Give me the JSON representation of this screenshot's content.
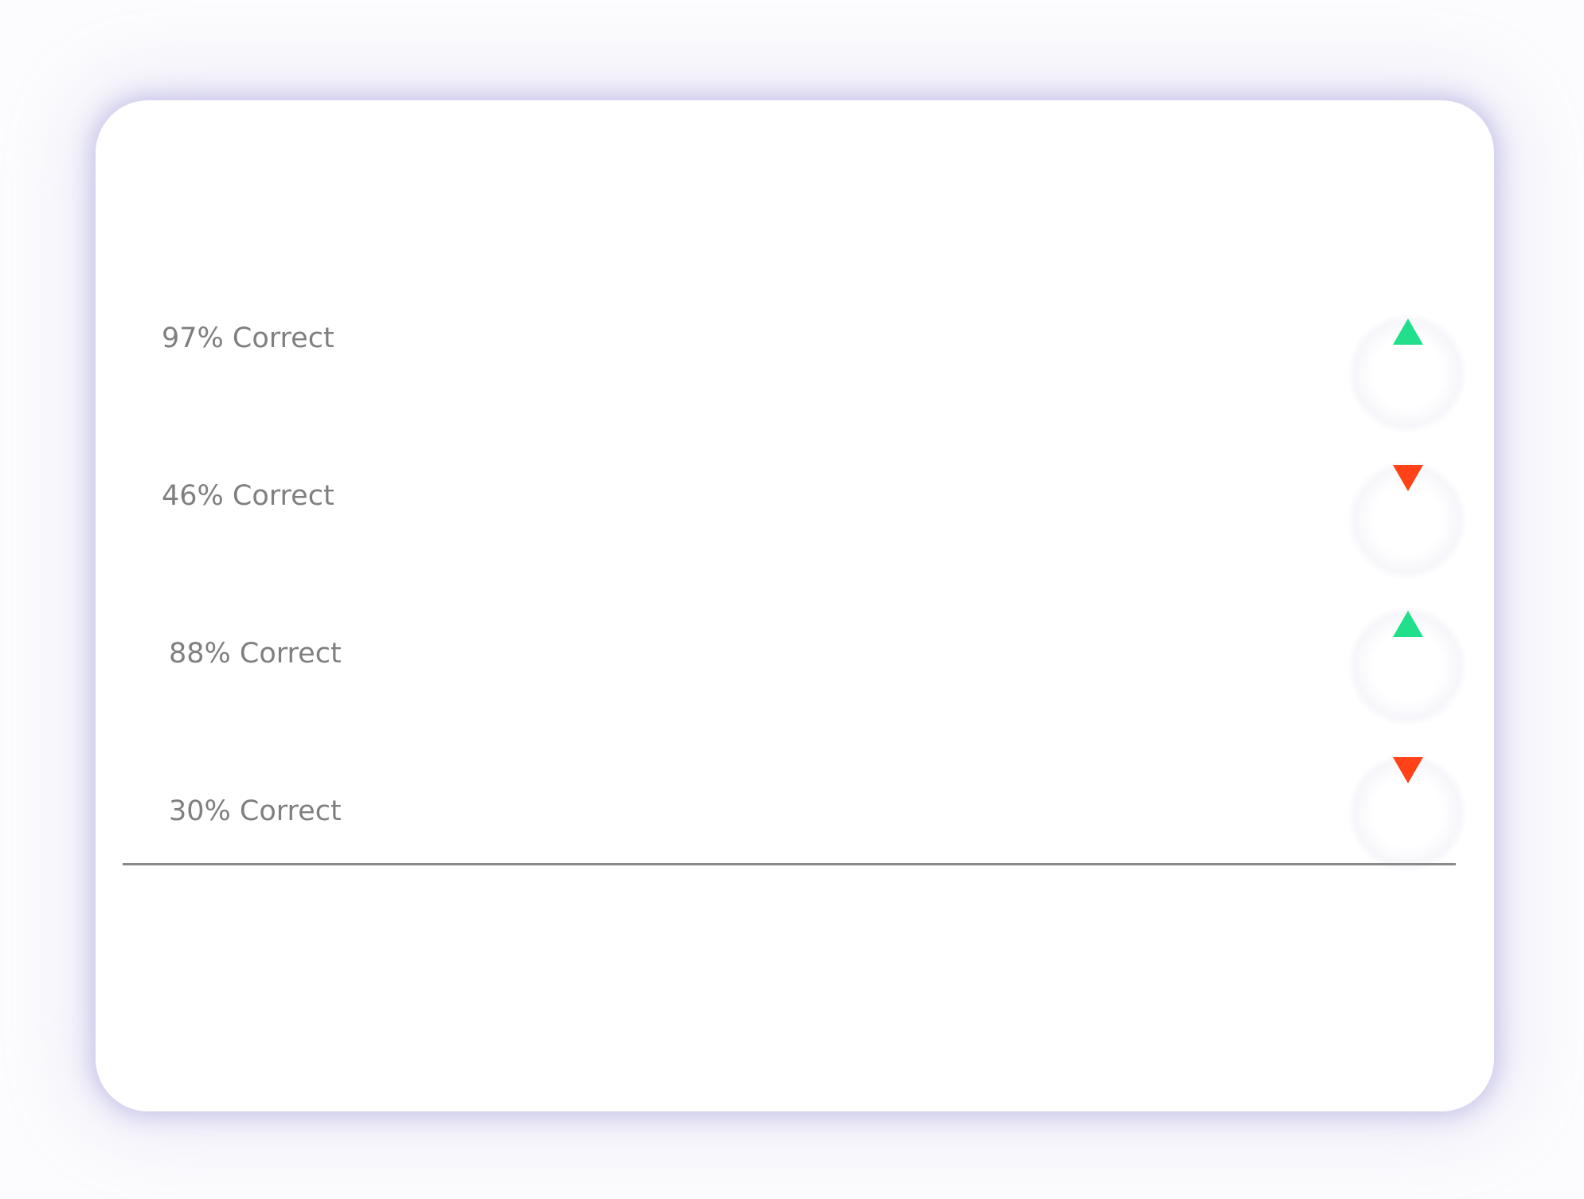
{
  "colors": {
    "up": "#21df8b",
    "down": "#ff4217",
    "label_text": "#7f7f7f",
    "divider": "#8a8a8a"
  },
  "rows": [
    {
      "label": "97% Correct",
      "trend": "up",
      "icon": "triangle-up-icon"
    },
    {
      "label": "46% Correct",
      "trend": "down",
      "icon": "triangle-down-icon"
    },
    {
      "label": "88% Correct",
      "trend": "up",
      "icon": "triangle-up-icon"
    },
    {
      "label": "30% Correct",
      "trend": "down",
      "icon": "triangle-down-icon"
    }
  ]
}
